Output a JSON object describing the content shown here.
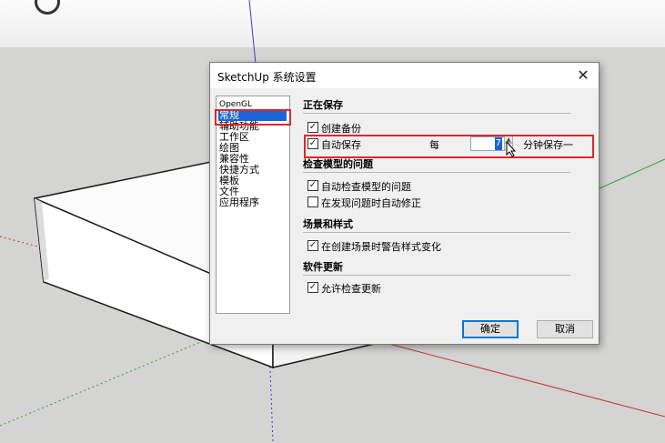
{
  "dialog": {
    "title": "SketchUp 系统设置",
    "close_glyph": "✕",
    "nav_items": [
      "OpenGL",
      "常规",
      "辅助功能",
      "工作区",
      "绘图",
      "兼容性",
      "快捷方式",
      "模板",
      "文件",
      "应用程序"
    ],
    "selected_nav": "常规",
    "sections": {
      "saving": {
        "title": "正在保存",
        "create_backup": {
          "label": "创建备份",
          "checked": true
        },
        "auto_save": {
          "label": "自动保存",
          "checked": true,
          "every_label": "每",
          "minutes": "7",
          "suffix": "分钟保存一"
        }
      },
      "check_models": {
        "title": "检查模型的问题",
        "auto_check": {
          "label": "自动检查模型的问题",
          "checked": true
        },
        "auto_fix": {
          "label": "在发现问题时自动修正",
          "checked": false
        }
      },
      "scenes": {
        "title": "场景和样式",
        "warn_style": {
          "label": "在创建场景时警告样式变化",
          "checked": true
        }
      },
      "updates": {
        "title": "软件更新",
        "allow_check": {
          "label": "允许检查更新",
          "checked": true
        }
      }
    },
    "ok_label": "确定",
    "cancel_label": "取消"
  },
  "colors": {
    "highlight_red": "#e0262b",
    "selection_blue": "#1a66d6",
    "axis_blue": "#3b3bd0",
    "axis_red": "#c23a2a",
    "axis_green": "#3aa03a"
  }
}
